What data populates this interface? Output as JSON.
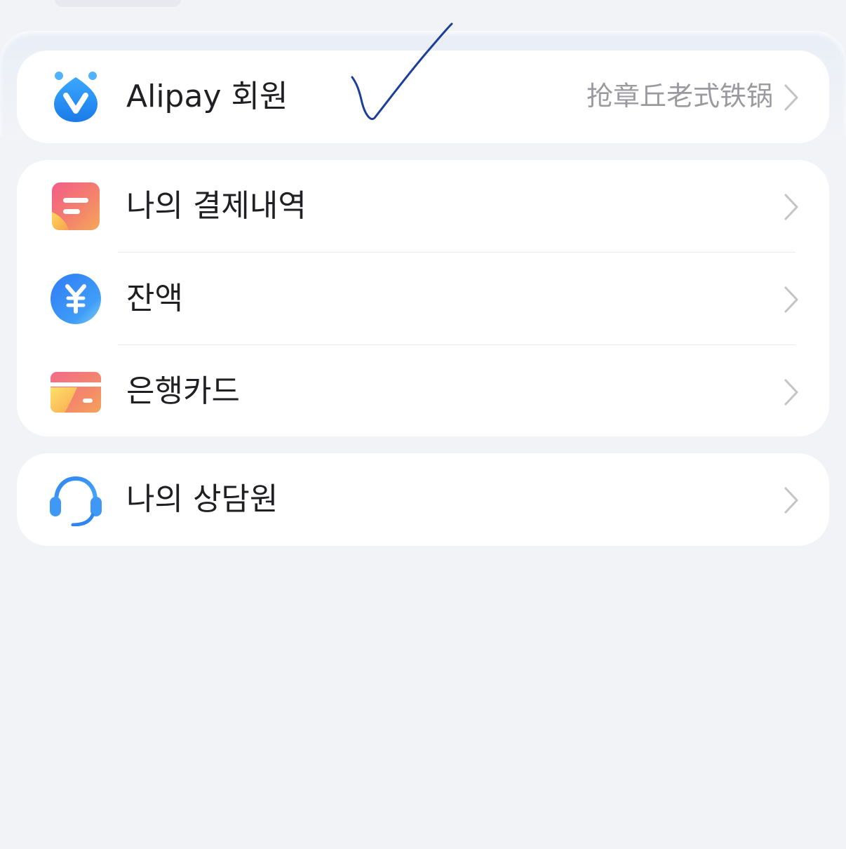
{
  "member_card": {
    "label": "Alipay 회원",
    "side_text": "抢章丘老式铁锅",
    "icon": "alipay-member-icon"
  },
  "payments_card": {
    "items": [
      {
        "label": "나의 결제내역",
        "icon": "bill-icon"
      },
      {
        "label": "잔액",
        "icon": "yuan-coin-icon"
      },
      {
        "label": "은행카드",
        "icon": "bank-card-icon"
      }
    ]
  },
  "support_card": {
    "label": "나의 상담원",
    "icon": "headset-icon"
  },
  "colors": {
    "background": "#f1f3f7",
    "card": "#ffffff",
    "text": "#1f1f24",
    "secondary_text": "#9a9aa0",
    "chevron": "#c4c4c8",
    "member_blue": "#2f8ff0",
    "handwritten_check": "#1c3f99"
  }
}
